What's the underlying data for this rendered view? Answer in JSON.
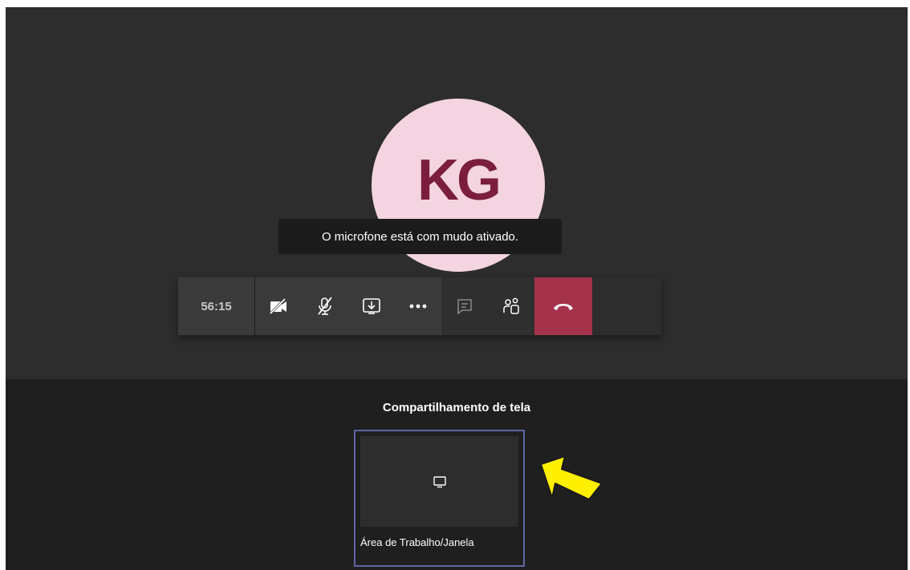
{
  "avatar": {
    "initials": "KG",
    "bg_color": "#f4d4e0",
    "text_color": "#7a1e3c"
  },
  "tooltip": {
    "text": "O microfone está com mudo ativado."
  },
  "controls": {
    "timer": "56:15",
    "buttons": [
      {
        "icon": "video-off-icon"
      },
      {
        "icon": "mic-off-icon"
      },
      {
        "icon": "share-tray-icon"
      },
      {
        "icon": "more-options-icon"
      },
      {
        "icon": "chat-icon"
      },
      {
        "icon": "participants-icon"
      },
      {
        "icon": "hang-up-icon",
        "color": "#a4324a"
      }
    ]
  },
  "share": {
    "title": "Compartilhamento de tela",
    "option_label": "Área de Trabalho/Janela",
    "option_icon": "monitor-icon",
    "border_color": "#6264a7"
  },
  "annotation": {
    "icon": "arrow-icon",
    "color": "#ffef00"
  }
}
